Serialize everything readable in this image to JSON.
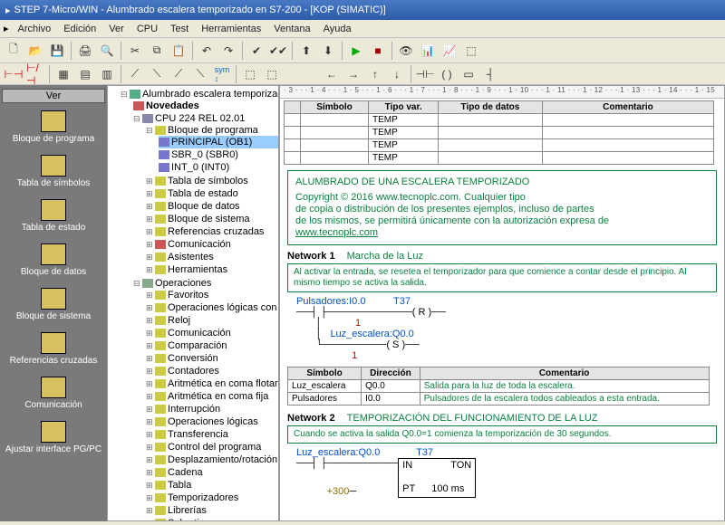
{
  "title": "STEP 7-Micro/WIN - Alumbrado escalera temporizado en S7-200 - [KOP (SIMATIC)]",
  "menu": {
    "archivo": "Archivo",
    "edicion": "Edición",
    "ver": "Ver",
    "cpu": "CPU",
    "test": "Test",
    "herramientas": "Herramientas",
    "ventana": "Ventana",
    "ayuda": "Ayuda"
  },
  "verHdr": "Ver",
  "sidebar": [
    "Bloque de programa",
    "Tabla de símbolos",
    "Tabla de estado",
    "Bloque de datos",
    "Bloque de sistema",
    "Referencias cruzadas",
    "Comunicación",
    "Ajustar interface PG/PC"
  ],
  "tree": {
    "root": "Alumbrado escalera temporizado e",
    "novedades": "Novedades",
    "cpu": "CPU 224 REL 02.01",
    "bloqueProg": "Bloque de programa",
    "principal": "PRINCIPAL (OB1)",
    "sbr": "SBR_0 (SBR0)",
    "int": "INT_0 (INT0)",
    "nodes1": [
      "Tabla de símbolos",
      "Tabla de estado",
      "Bloque de datos",
      "Bloque de sistema",
      "Referencias cruzadas",
      "Comunicación",
      "Asistentes",
      "Herramientas"
    ],
    "ops": "Operaciones",
    "opsChildren": [
      "Favoritos",
      "Operaciones lógicas con bits",
      "Reloj",
      "Comunicación",
      "Comparación",
      "Conversión",
      "Contadores",
      "Aritmética en coma flotante",
      "Aritmética en coma fija",
      "Interrupción",
      "Operaciones lógicas",
      "Transferencia",
      "Control del programa",
      "Desplazamiento/rotación",
      "Cadena",
      "Tabla",
      "Temporizadores",
      "Librerías",
      "Subrutinas"
    ]
  },
  "ruler": "· 3 · · · 1 · 4 · · · 1 · 5 · · · 1 · 6 · · · 1 · 7 · · · 1 · 8 · · · 1 · 9 · · · 1 · 10 · · · 1 · 11 · · · 1 · 12 · · · 1 · 13 · · · 1 · 14 · · · 1 · 15",
  "symHeaders": {
    "simbolo": "Símbolo",
    "tipovar": "Tipo var.",
    "tipodatos": "Tipo de datos",
    "comentario": "Comentario"
  },
  "tempRows": [
    "TEMP",
    "TEMP",
    "TEMP",
    "TEMP"
  ],
  "gbTitle": "ALUMBRADO DE UNA ESCALERA TEMPORIZADO",
  "gbBody1": "Copyright © 2016 www.tecnoplc.com. Cualquier tipo",
  "gbBody2": "de copia o distribución de los presentes ejemplos, incluso de partes",
  "gbBody3": "de los mismos, se permitirá únicamente con la autorización expresa de",
  "gbLink": "www.tecnoplc.com",
  "net1": {
    "num": "Network 1",
    "name": "Marcha de la Luz",
    "comment": "Al activar la entrada, se resetea el temporizador para que comience a contar desde el principio. Al mismo tiempo se activa la salida.",
    "l1": "Pulsadores:I0.0",
    "t37": "T37",
    "r": "R",
    "one1": "1",
    "luz": "Luz_escalera:Q0.0",
    "s": "S",
    "one2": "1"
  },
  "ioHeaders": {
    "sim": "Símbolo",
    "dir": "Dirección",
    "com": "Comentario"
  },
  "ioRows": [
    {
      "s": "Luz_escalera",
      "d": "Q0.0",
      "c": "Salida para la luz de toda la escalera."
    },
    {
      "s": "Pulsadores",
      "d": "I0.0",
      "c": "Pulsadores de la escalera todos cableados a esta entrada."
    }
  ],
  "net2": {
    "num": "Network 2",
    "name": "TEMPORIZACIÓN DEL FUNCIONAMIENTO DE LA LUZ",
    "comment": "Cuando se activa la salida Q0.0=1 comienza la temporización de 30 segundos.",
    "luz": "Luz_escalera:Q0.0",
    "t37": "T37",
    "in": "IN",
    "ton": "TON",
    "pt": "PT",
    "val": "+300",
    "ms": "100 ms"
  }
}
